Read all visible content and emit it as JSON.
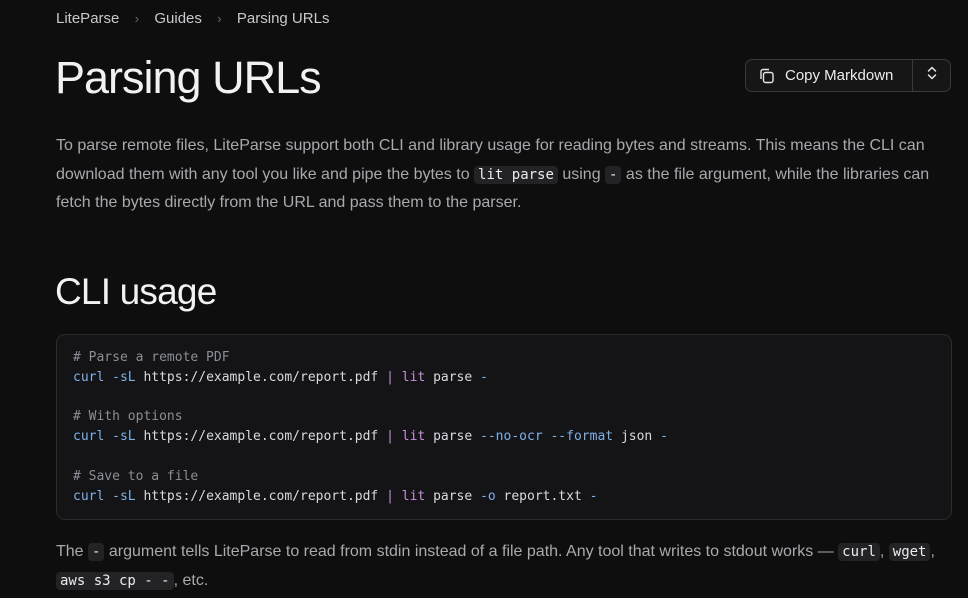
{
  "breadcrumb": [
    "LiteParse",
    "Guides",
    "Parsing URLs"
  ],
  "page_title": "Parsing URLs",
  "copy_button": {
    "label": "Copy Markdown",
    "icon": "copy-icon",
    "menu_icon": "chevron-up-down-icon"
  },
  "intro": {
    "part1": "To parse remote files, LiteParse support both CLI and library usage for reading bytes and streams. This means the CLI can download them with any tool you like and pipe the bytes to ",
    "code1": "lit parse",
    "part2": " using ",
    "code2": "-",
    "part3": " as the file argument, while the libraries can fetch the bytes directly from the URL and pass them to the parser."
  },
  "section_title": "CLI usage",
  "code_block": {
    "lines": [
      "# Parse a remote PDF",
      "curl -sL https://example.com/report.pdf | lit parse -",
      "",
      "# With options",
      "curl -sL https://example.com/report.pdf | lit parse --no-ocr --format json -",
      "",
      "# Save to a file",
      "curl -sL https://example.com/report.pdf | lit parse -o report.txt -"
    ]
  },
  "outro": {
    "part1": "The ",
    "code1": "-",
    "part2": " argument tells LiteParse to read from stdin instead of a file path. Any tool that writes to stdout works — ",
    "code2": "curl",
    "part3": ", ",
    "code3": "wget",
    "part4": ", ",
    "code4": "aws s3 cp - -",
    "part5": ", etc."
  },
  "colors": {
    "background": "#0e0e0f",
    "comment": "#8b8e96",
    "command": "#7fb0e8",
    "pipe": "#c78fd8"
  }
}
